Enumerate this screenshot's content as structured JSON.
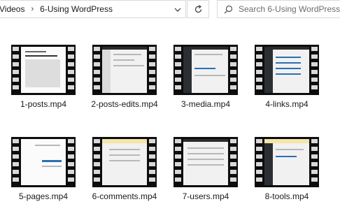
{
  "address_bar": {
    "crumbs": [
      "Videos",
      "6-Using WordPress"
    ],
    "dropdown_icon": "chevron-down-icon"
  },
  "refresh_icon": "refresh-icon",
  "search": {
    "placeholder": "Search 6-Using WordPress",
    "icon": "search-icon"
  },
  "files": [
    {
      "name": "1-posts.mp4",
      "thumbnail": "editor"
    },
    {
      "name": "2-posts-edits.mp4",
      "thumbnail": "dashboard"
    },
    {
      "name": "3-media.mp4",
      "thumbnail": "dashboard"
    },
    {
      "name": "4-links.mp4",
      "thumbnail": "list"
    },
    {
      "name": "5-pages.mp4",
      "thumbnail": "menu"
    },
    {
      "name": "6-comments.mp4",
      "thumbnail": "yellow"
    },
    {
      "name": "7-users.mp4",
      "thumbnail": "list"
    },
    {
      "name": "8-tools.mp4",
      "thumbnail": "yellow"
    }
  ],
  "colors": {
    "filmstrip": "#0d0d0d",
    "sprocket": "#d9d9d9",
    "border": "#d9d9d9"
  }
}
